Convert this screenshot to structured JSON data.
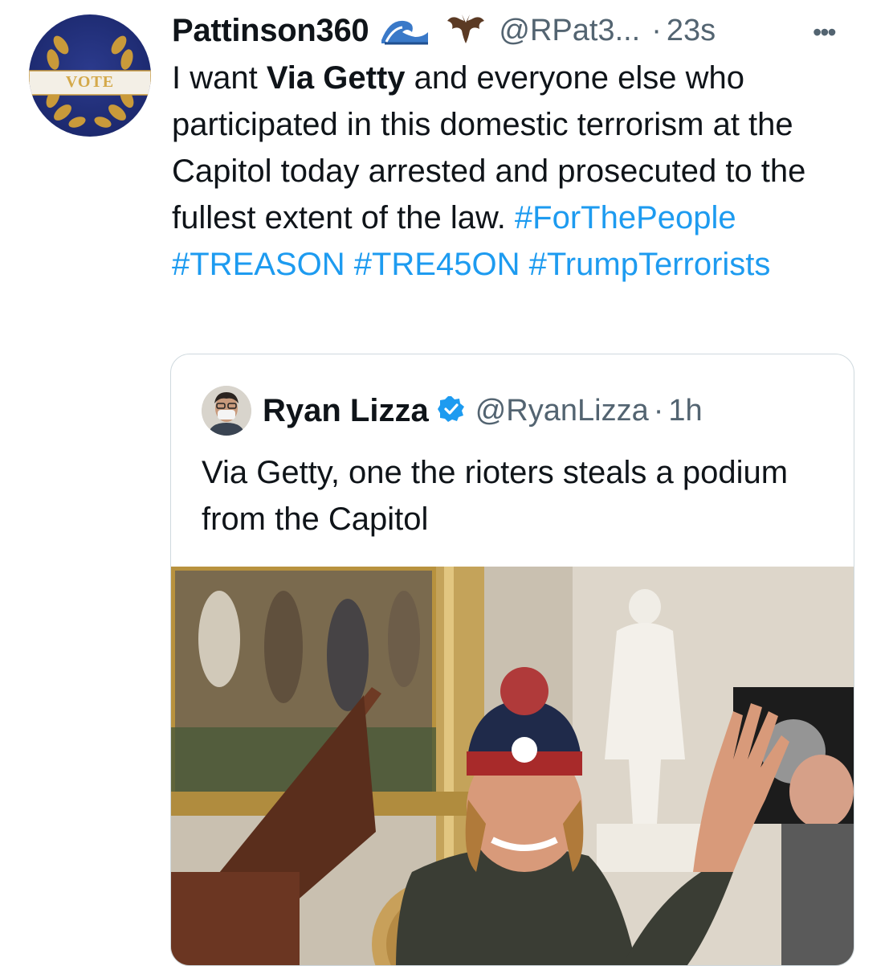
{
  "tweet": {
    "display_name": "Pattinson360",
    "emoji_1": "wave-icon",
    "emoji_2": "bat-icon",
    "handle": "@RPat3...",
    "dot": "·",
    "time": "23s",
    "more": "•••",
    "avatar_text": "VOTE",
    "text_parts": {
      "p1": "I want ",
      "p2": "Via Getty",
      "p3": " and everyone else who participated in this domestic terrorism at the Capitol today arrested and prosecuted to the fullest extent of the law. ",
      "tag1": "#ForThePeople",
      "tag2": "#TREASON",
      "tag3": "#TRE45ON",
      "tag4": "#TrumpTerrorists"
    }
  },
  "quote": {
    "display_name": "Ryan Lizza",
    "verified": "verified-badge-icon",
    "handle": "@RyanLizza",
    "dot": "·",
    "time": "1h",
    "text": "Via Getty, one the rioters steals a podium from the Capitol",
    "photo": "rioter-with-podium-photo"
  },
  "colors": {
    "hashtag": "#1d9bf0",
    "secondary": "#536471",
    "border": "#cfd9de"
  }
}
